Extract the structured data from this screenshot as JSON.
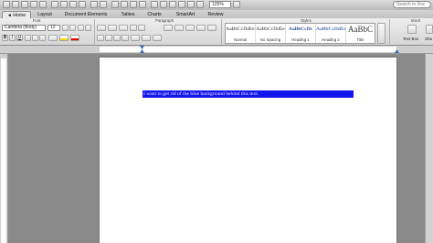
{
  "toolbar": {
    "zoom_value": "125%",
    "search_placeholder": "Search in Doc"
  },
  "tabs": [
    "Home",
    "Layout",
    "Document Elements",
    "Tables",
    "Charts",
    "SmartArt",
    "Review"
  ],
  "ribbon": {
    "groups": {
      "font": "Font",
      "paragraph": "Paragraph",
      "styles": "Styles",
      "insert": "Insert"
    },
    "font_name": "Cambria (Body)",
    "font_size": "12",
    "bold": "B",
    "italic": "I",
    "underline": "U",
    "styles_gallery": [
      {
        "sample": "AaBbCcDdEe",
        "name": "Normal"
      },
      {
        "sample": "AaBbCcDdEe",
        "name": "No Spacing"
      },
      {
        "sample": "AaBbCcDc",
        "name": "Heading 1"
      },
      {
        "sample": "AaBbCcDdEe",
        "name": "Heading 2"
      },
      {
        "sample": "AaBbC",
        "name": "Title"
      }
    ],
    "text_box_label": "Text Box",
    "shape_label": "Sha"
  },
  "document": {
    "selected_text": "I want to get rid of the blue background behind this text.",
    "highlight_color": "#1515ee"
  }
}
